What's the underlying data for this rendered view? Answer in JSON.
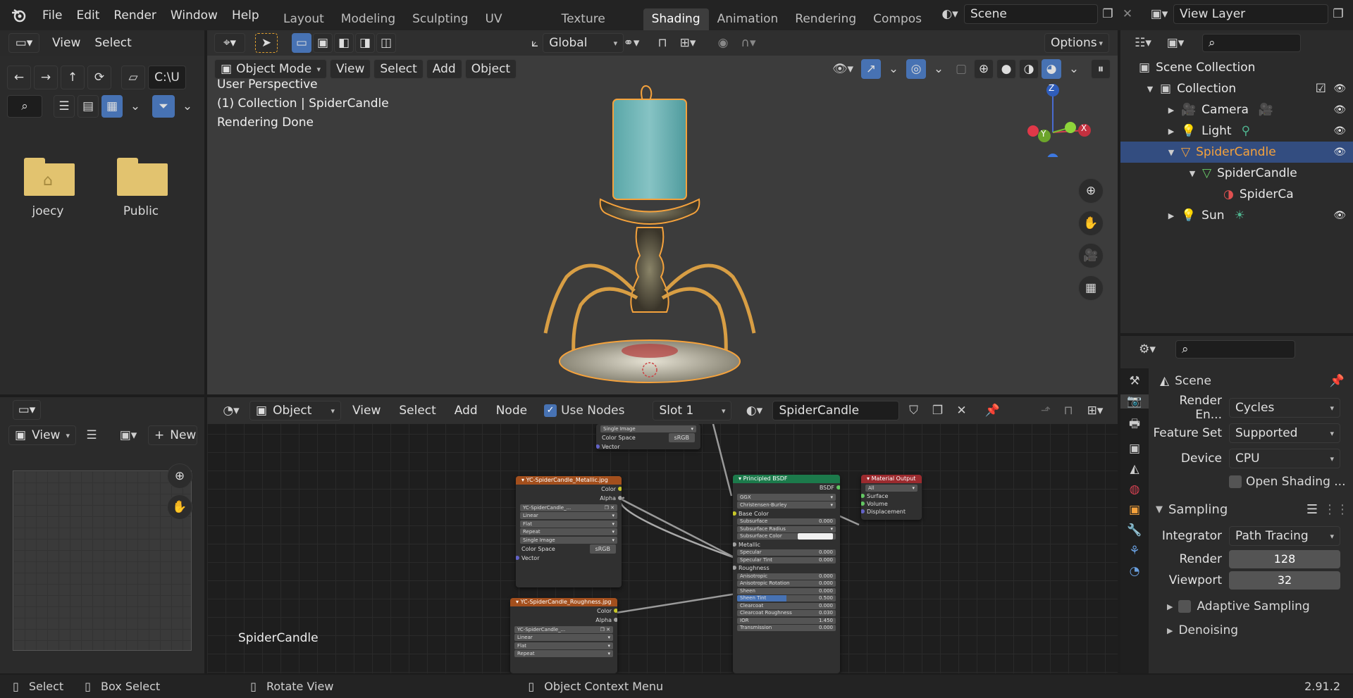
{
  "app": {
    "menu": [
      "File",
      "Edit",
      "Render",
      "Window",
      "Help"
    ],
    "workspace_tabs": [
      "Layout",
      "Modeling",
      "Sculpting",
      "UV Editing",
      "Texture Paint",
      "Shading",
      "Animation",
      "Rendering",
      "Compos"
    ],
    "active_tab": "Shading",
    "scene_name": "Scene",
    "view_layer": "View Layer"
  },
  "file_browser": {
    "menu": [
      "View",
      "Select"
    ],
    "path": "C:\\U",
    "folders": [
      {
        "name": "joecy",
        "icon": "home-folder-icon"
      },
      {
        "name": "Public",
        "icon": "folder-icon"
      }
    ]
  },
  "viewport": {
    "mode": "Object Mode",
    "menu": [
      "View",
      "Select",
      "Add",
      "Object"
    ],
    "transform_orientation": "Global",
    "options_label": "Options",
    "overlay_text": [
      "User Perspective",
      "(1) Collection | SpiderCandle",
      "Rendering Done"
    ],
    "gizmo": {
      "x": "X",
      "y": "Y",
      "z": "Z"
    }
  },
  "image_editor": {
    "view_label": "View",
    "new_label": "New"
  },
  "node_editor": {
    "editor_type": "Object",
    "menu": [
      "View",
      "Select",
      "Add",
      "Node"
    ],
    "use_nodes_label": "Use Nodes",
    "use_nodes_checked": true,
    "slot": "Slot 1",
    "material": "SpiderCandle",
    "footer_label": "SpiderCandle",
    "nodes": {
      "top_partial": {
        "rows": [
          "Single Image"
        ],
        "color_space_label": "Color Space",
        "color_space_value": "sRGB",
        "vector": "Vector"
      },
      "metallic": {
        "title": "YC-SpiderCandle_Metallic.jpg",
        "outputs": [
          "Color",
          "Alpha"
        ],
        "image": "YC-SpiderCandle_...",
        "fields": [
          "Linear",
          "Flat",
          "Repeat",
          "Single Image"
        ],
        "color_space_label": "Color Space",
        "color_space_value": "sRGB",
        "vector": "Vector"
      },
      "roughness": {
        "title": "YC-SpiderCandle_Roughness.jpg",
        "outputs": [
          "Color",
          "Alpha"
        ],
        "image": "YC-SpiderCandle_...",
        "fields": [
          "Linear",
          "Flat",
          "Repeat"
        ]
      },
      "bsdf": {
        "title": "Principled BSDF",
        "output": "BSDF",
        "dists": [
          "GGX",
          "Christensen-Burley"
        ],
        "rows": [
          {
            "label": "Base Color",
            "type": "socket"
          },
          {
            "label": "Subsurface",
            "value": "0.000"
          },
          {
            "label": "Subsurface Radius",
            "type": "dropdown"
          },
          {
            "label": "Subsurface Color",
            "type": "color"
          },
          {
            "label": "Metallic",
            "type": "socket"
          },
          {
            "label": "Specular",
            "value": "0.000"
          },
          {
            "label": "Specular Tint",
            "value": "0.000"
          },
          {
            "label": "Roughness",
            "type": "socket"
          },
          {
            "label": "Anisotropic",
            "value": "0.000"
          },
          {
            "label": "Anisotropic Rotation",
            "value": "0.000"
          },
          {
            "label": "Sheen",
            "value": "0.000"
          },
          {
            "label": "Sheen Tint",
            "value": "0.500"
          },
          {
            "label": "Clearcoat",
            "value": "0.000"
          },
          {
            "label": "Clearcoat Roughness",
            "value": "0.030"
          },
          {
            "label": "IOR",
            "value": "1.450"
          },
          {
            "label": "Transmission",
            "value": "0.000"
          }
        ]
      },
      "output": {
        "title": "Material Output",
        "target": "All",
        "inputs": [
          "Surface",
          "Volume",
          "Displacement"
        ]
      }
    }
  },
  "outliner": {
    "items": [
      {
        "label": "Scene Collection",
        "depth": 0,
        "icon": "scene-collection-icon"
      },
      {
        "label": "Collection",
        "depth": 1,
        "icon": "collection-icon",
        "expanded": true
      },
      {
        "label": "Camera",
        "depth": 2,
        "icon": "camera-icon"
      },
      {
        "label": "Light",
        "depth": 2,
        "icon": "light-icon"
      },
      {
        "label": "SpiderCandle",
        "depth": 2,
        "icon": "mesh-object-icon",
        "selected": true,
        "expanded": true
      },
      {
        "label": "SpiderCandle",
        "depth": 3,
        "icon": "mesh-data-icon",
        "expanded": true
      },
      {
        "label": "SpiderCa",
        "depth": 4,
        "icon": "material-icon"
      },
      {
        "label": "Sun",
        "depth": 2,
        "icon": "sun-icon"
      }
    ]
  },
  "properties": {
    "context": "Scene",
    "render_engine_label": "Render En...",
    "render_engine": "Cycles",
    "feature_set_label": "Feature Set",
    "feature_set": "Supported",
    "device_label": "Device",
    "device": "CPU",
    "open_shading_label": "Open Shading ...",
    "sampling_label": "Sampling",
    "integrator_label": "Integrator",
    "integrator": "Path Tracing",
    "render_label": "Render",
    "render_samples": "128",
    "viewport_label": "Viewport",
    "viewport_samples": "32",
    "adaptive_label": "Adaptive Sampling",
    "denoising_label": "Denoising"
  },
  "status_bar": {
    "select": "Select",
    "box_select": "Box Select",
    "rotate": "Rotate View",
    "context_menu": "Object Context Menu",
    "version": "2.91.2"
  },
  "colors": {
    "accent": "#4772b3",
    "selection": "#334d80",
    "object_orange": "#f5a23c",
    "node_texture": "#a34f1d",
    "node_shader": "#1c7a4b",
    "node_output": "#9b2a2e"
  }
}
